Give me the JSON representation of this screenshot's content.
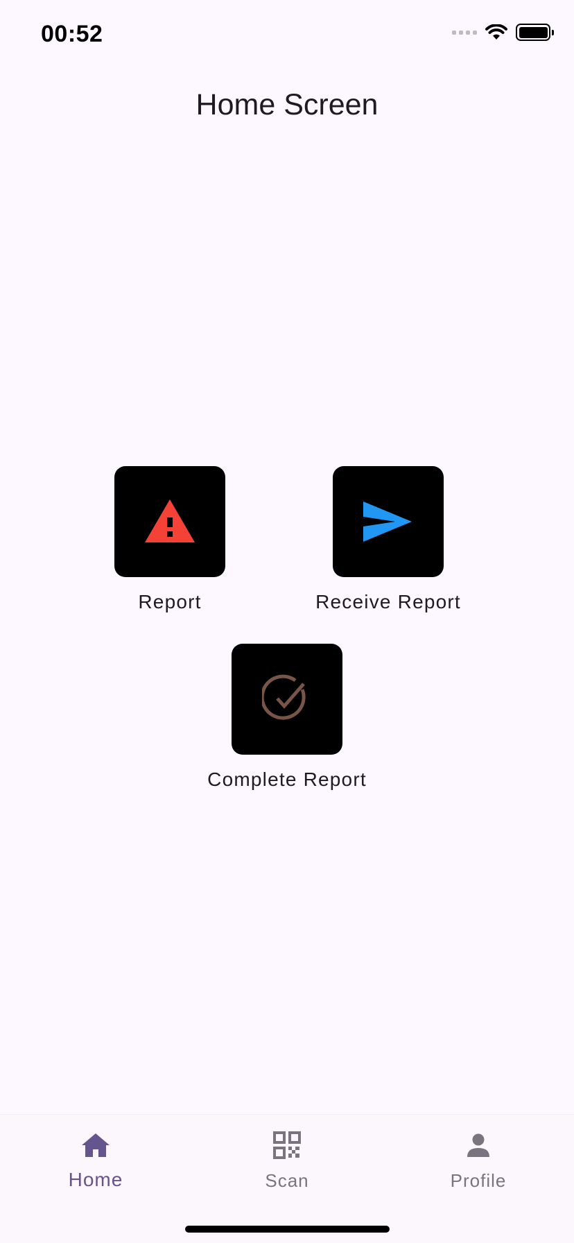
{
  "status_bar": {
    "time": "00:52"
  },
  "app_bar": {
    "title": "Home Screen"
  },
  "actions": {
    "report": {
      "label": "Report",
      "icon": "warning-icon",
      "icon_color": "#f44336"
    },
    "receive_report": {
      "label": "Receive Report",
      "icon": "send-icon",
      "icon_color": "#2196f3"
    },
    "complete_report": {
      "label": "Complete Report",
      "icon": "check-circle-icon",
      "icon_color": "#795548"
    }
  },
  "bottom_nav": {
    "items": [
      {
        "label": "Home",
        "icon": "home-icon",
        "selected": true
      },
      {
        "label": "Scan",
        "icon": "qr-code-icon",
        "selected": false
      },
      {
        "label": "Profile",
        "icon": "person-icon",
        "selected": false
      }
    ]
  },
  "colors": {
    "background": "#fdf7ff",
    "nav_selected": "#65558f",
    "nav_unselected": "#79747e",
    "tile_background": "#000000"
  }
}
